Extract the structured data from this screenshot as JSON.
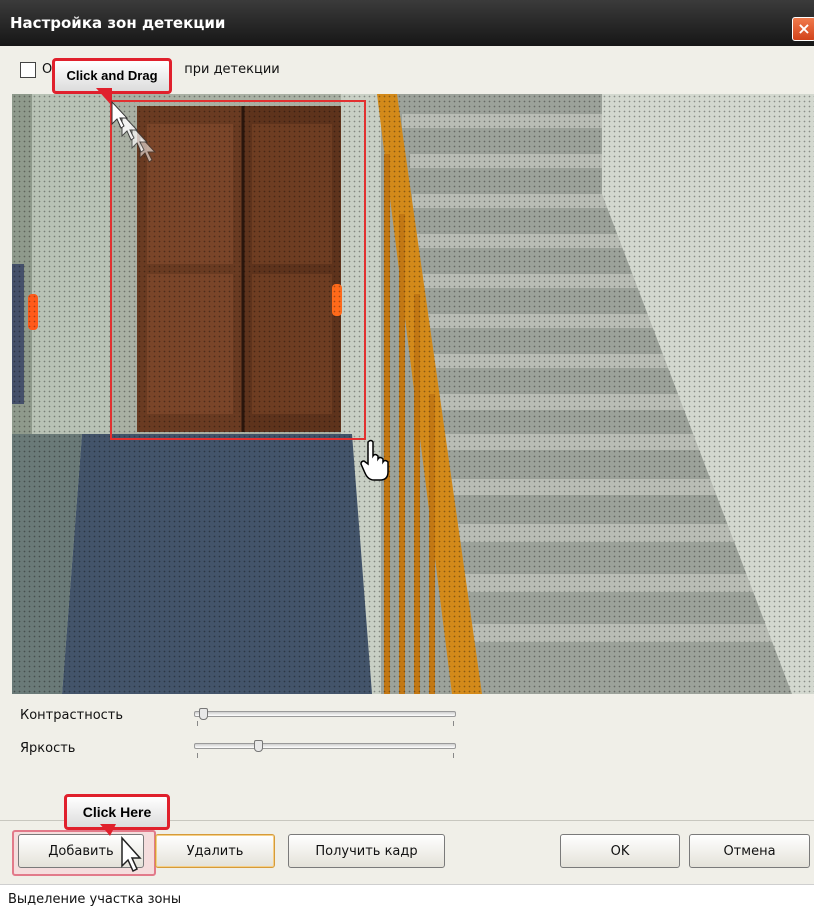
{
  "window": {
    "title": "Настройка зон детекции",
    "close_symbol": "×"
  },
  "options": {
    "checkbox_label_visible_start": "О",
    "checkbox_label_visible_end": "при детекции",
    "checked": false
  },
  "sliders": {
    "contrast_label": "Контрастность",
    "contrast_position": 0.02,
    "brightness_label": "Яркость",
    "brightness_position": 0.24
  },
  "buttons": {
    "add_label": "Добавить",
    "delete_label": "Удалить",
    "get_frame_label": "Получить кадр",
    "ok_label": "OK",
    "cancel_label": "Отмена"
  },
  "status": {
    "text": "Выделение участка зоны"
  },
  "annotations": {
    "drag_callout": "Click and Drag",
    "click_callout": "Click Here"
  },
  "icons": {
    "close": "close-icon",
    "arrow_cursor": "arrow-cursor-icon",
    "hand_cursor": "hand-cursor-icon"
  },
  "colors": {
    "titlebar": "#1f1f1f",
    "selection": "#e23030",
    "callout_border": "#e0202c",
    "close_button": "#d2431b"
  }
}
